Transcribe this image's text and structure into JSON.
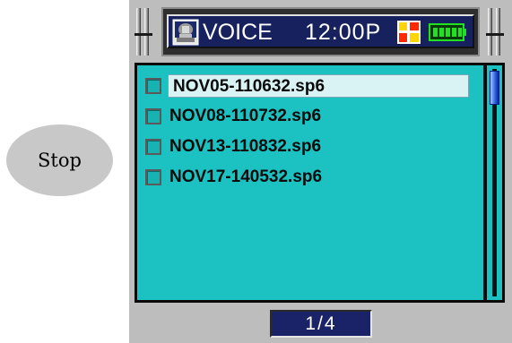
{
  "stop_button": {
    "label": "Stop"
  },
  "status_bar": {
    "icon": "voice-recorder-icon",
    "mode": "VOICE",
    "time": "12:00P",
    "flag_icon": "multicolor-flag-icon",
    "battery_icon": "battery-full-icon",
    "colors": {
      "background": "#16215e",
      "text": "#ffffff",
      "battery": "#22e022"
    }
  },
  "file_list": {
    "items": [
      {
        "name": "NOV05-110632.sp6",
        "selected": true
      },
      {
        "name": "NOV08-110732.sp6",
        "selected": false
      },
      {
        "name": "NOV13-110832.sp6",
        "selected": false
      },
      {
        "name": "NOV17-140532.sp6",
        "selected": false
      }
    ],
    "colors": {
      "background": "#1cc1c1",
      "selection": "#d9f2f4"
    }
  },
  "pager": {
    "label": "1/4"
  }
}
